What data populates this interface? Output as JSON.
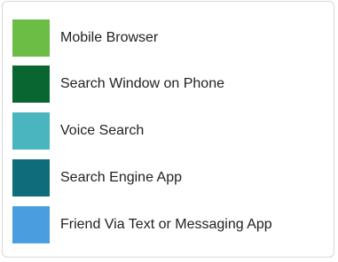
{
  "chart_data": {
    "type": "legend",
    "legend": [
      {
        "label": "Mobile Browser",
        "color": "#6bbd45"
      },
      {
        "label": "Search Window on Phone",
        "color": "#0a6630"
      },
      {
        "label": "Voice Search",
        "color": "#4ab5bf"
      },
      {
        "label": "Search Engine App",
        "color": "#0f6d7a"
      },
      {
        "label": "Friend Via Text or Messaging App",
        "color": "#4a9ee0"
      }
    ]
  }
}
